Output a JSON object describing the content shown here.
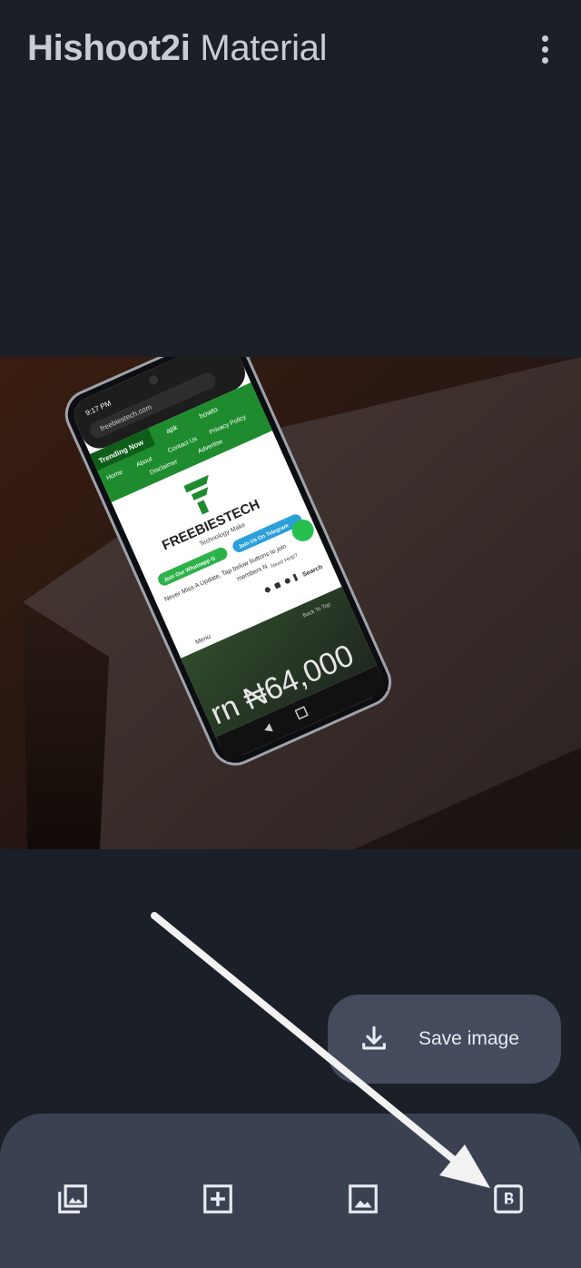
{
  "app": {
    "title_bold": "Hishoot2i",
    "title_light": " Material",
    "overflow_icon": "more-vert-icon"
  },
  "preview": {
    "phone": {
      "status_time": "9:17 PM",
      "url": "freebiestech.com",
      "menu_bar": [
        "Trending Now",
        "apk",
        "howto"
      ],
      "nav_links": [
        "Home",
        "About",
        "Contact Us",
        "Privacy Policy",
        "Disclaimer",
        "Advertise"
      ],
      "logo_text": "FREEBIESTECH",
      "tagline": "Technology Make",
      "whatsapp_button": "Join Our Whatsapp G",
      "telegram_button": "Join Us On Telegram",
      "notice": "Never Miss A Update, Tap below buttons to join",
      "notice2": "members N",
      "need_help": "Need Help?",
      "search_label": "Search",
      "menu_label": "Menu",
      "banner_text": "rn ₦64,000",
      "back_to_top": "Back To Top"
    }
  },
  "fab": {
    "label": "Save image",
    "icon": "download-icon"
  },
  "bottom_bar": {
    "buttons": [
      {
        "name": "screenshot-library",
        "icon": "photo-library-icon"
      },
      {
        "name": "add",
        "icon": "add-box-icon"
      },
      {
        "name": "background-image",
        "icon": "image-icon"
      },
      {
        "name": "badge",
        "icon": "badge-b-icon"
      }
    ]
  },
  "colors": {
    "background": "#1b1f28",
    "fab": "#434b5c",
    "bottom_bar": "#3a4252",
    "site_green": "#1e8c2e"
  }
}
